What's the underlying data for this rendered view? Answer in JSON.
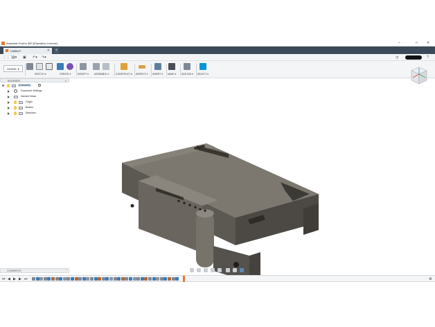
{
  "window": {
    "title": "Autodesk Fusion 360 (Education License)",
    "minimize": "–",
    "maximize": "□",
    "close": "✕"
  },
  "tab": {
    "name": "Untitled*",
    "close": "✕",
    "new_tab": "+"
  },
  "quick_access": {
    "grid": "⋮⋮⋮",
    "file": "▤▾",
    "save": "▣",
    "undo": "↶▾",
    "redo": "↷▾",
    "clock": "◷",
    "help": "?"
  },
  "toolbar": {
    "mode": "MODEL ▾",
    "groups": [
      {
        "label": "SKETCH ▾"
      },
      {
        "label": "CREATE ▾"
      },
      {
        "label": "MODIFY ▾"
      },
      {
        "label": "ASSEMBLE ▾"
      },
      {
        "label": "CONSTRUCT ▾"
      },
      {
        "label": "INSPECT ▾"
      },
      {
        "label": "INSERT ▾"
      },
      {
        "label": "MAKE ▾"
      },
      {
        "label": "ADD-INS ▾"
      },
      {
        "label": "SELECT ▾"
      }
    ]
  },
  "browser": {
    "header": "BROWSER",
    "collapse": "«",
    "root": "(Unsaved)",
    "items": [
      {
        "label": "Document Settings"
      },
      {
        "label": "Named Views"
      },
      {
        "label": "Origin"
      },
      {
        "label": "Bodies"
      },
      {
        "label": "Sketches"
      }
    ]
  },
  "comments": {
    "label": "COMMENTS",
    "add": "+"
  },
  "timeline": {
    "first": "⏮",
    "prev": "◀",
    "play": "▶",
    "next": "▶",
    "last": "⏭",
    "settings": "⚙",
    "feature_count": 38
  },
  "colors": {
    "accent": "#e8772e",
    "tabbar": "#3b4a5a",
    "select": "#0696d7",
    "model_top": "#7c7870",
    "model_front": "#5c5953",
    "model_side": "#4a4742"
  }
}
